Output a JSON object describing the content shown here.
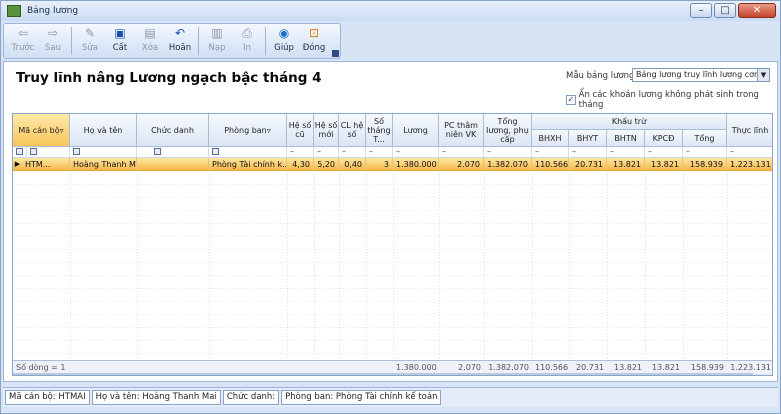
{
  "window": {
    "title": "Bảng lương"
  },
  "toolbar": {
    "buttons": [
      {
        "label": "Trước",
        "icon": "arrow-left-icon",
        "disabled": true
      },
      {
        "label": "Sau",
        "icon": "arrow-right-icon",
        "disabled": true
      },
      {
        "label": "Sửa",
        "icon": "edit-icon",
        "disabled": true
      },
      {
        "label": "Cất",
        "icon": "save-icon",
        "disabled": false
      },
      {
        "label": "Xóa",
        "icon": "delete-icon",
        "disabled": true
      },
      {
        "label": "Hoãn",
        "icon": "undo-icon",
        "disabled": false
      },
      {
        "label": "Nạp",
        "icon": "load-icon",
        "disabled": true
      },
      {
        "label": "In",
        "icon": "print-icon",
        "disabled": true
      },
      {
        "label": "Giúp",
        "icon": "help-icon",
        "disabled": false
      },
      {
        "label": "Đóng",
        "icon": "close-icon",
        "disabled": false
      }
    ]
  },
  "report": {
    "title": "Truy lĩnh nâng Lương ngạch bậc tháng 4",
    "template_label": "Mẫu bảng lương",
    "template_value": "Bảng lương truy lĩnh lương cơn",
    "hide_label": "Ẩn các khoản lương không phát sinh trong tháng",
    "hide_checked": "✓"
  },
  "grid": {
    "headers": {
      "ma_can_bo": "Mã cán bộ",
      "ho_va_ten": "Họ và tên",
      "chuc_danh": "Chức danh",
      "phong_ban": "Phòng ban",
      "he_so_cu": "Hệ số cũ",
      "he_so_moi": "Hệ số mới",
      "cl_he_so": "CL hệ số",
      "so_thang": "Số tháng T...",
      "luong": "Lương",
      "pc_tham_nien": "PC thâm niên VK",
      "tong_luong_pc": "Tổng lương, phụ cấp",
      "khau_tru": "Khấu trừ",
      "bhxh": "BHXH",
      "bhyt": "BHYT",
      "bhtn": "BHTN",
      "kpcd": "KPCĐ",
      "tong": "Tổng",
      "thuc_linh": "Thực lĩnh"
    },
    "row": {
      "ma_can_bo": "HTM...",
      "ho_va_ten": "Hoàng Thanh Mai",
      "chuc_danh": "",
      "phong_ban": "Phòng Tài chính k...",
      "he_so_cu": "4,30",
      "he_so_moi": "5,20",
      "cl_he_so": "0,40",
      "so_thang": "3",
      "luong": "1.380.000",
      "pc_tham_nien": "2.070",
      "tong_luong_pc": "1.382.070",
      "bhxh": "110.566",
      "bhyt": "20.731",
      "bhtn": "13.821",
      "kpcd": "13.821",
      "tong": "158.939",
      "thuc_linh": "1.223.131"
    },
    "footer": {
      "count": "Số dòng = 1",
      "luong": "1.380.000",
      "pc_tham_nien": "2.070",
      "tong_luong_pc": "1.382.070",
      "bhxh": "110.566",
      "bhyt": "20.731",
      "bhtn": "13.821",
      "kpcd": "13.821",
      "tong": "158.939",
      "thuc_linh": "1.223.131"
    }
  },
  "statusbar": {
    "ma_can_bo": "Mã cán bộ: HTMAI",
    "ho_va_ten": "Họ và tên: Hoàng Thanh Mai",
    "chuc_danh": "Chức danh:",
    "phong_ban": "Phòng ban: Phòng Tài chính kế toán"
  }
}
